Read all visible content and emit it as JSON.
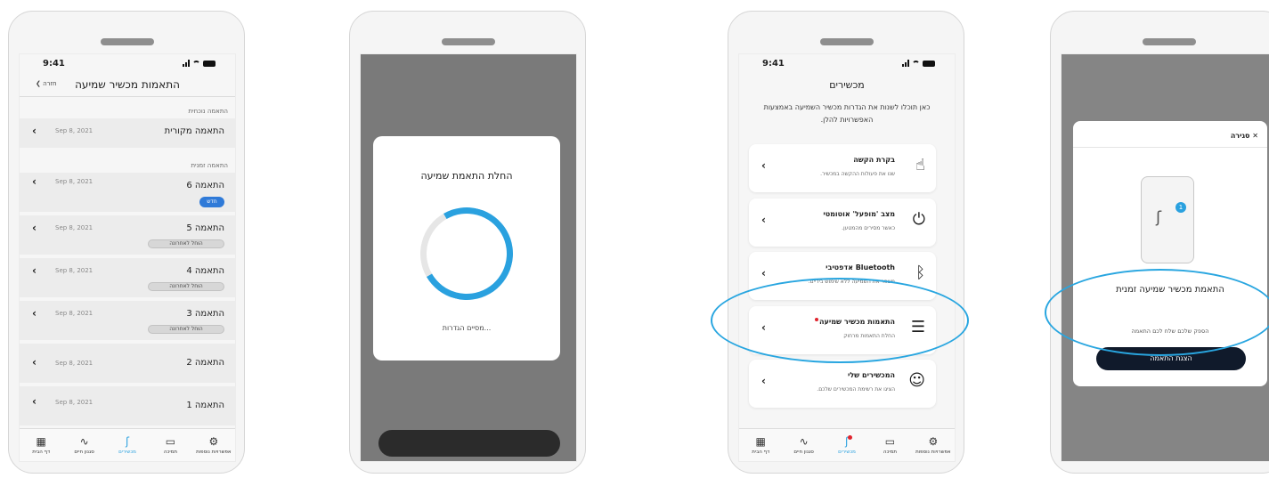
{
  "status_time": "9:41",
  "phone1": {
    "header_title": "התאמות מכשיר שמיעה",
    "back_label": "חזרה",
    "current_section": "התאמה נוכחית",
    "original_fitting": {
      "name": "התאמה מקורית",
      "date": "Sep 8, 2021"
    },
    "temp_section": "התאמה זמנית",
    "fittings": [
      {
        "name": "התאמה 6",
        "date": "Sep 8, 2021",
        "badge": "חדש"
      },
      {
        "name": "התאמה 5",
        "date": "Sep 8, 2021",
        "badge": "הוחל לאחרונה"
      },
      {
        "name": "התאמה 4",
        "date": "Sep 8, 2021",
        "badge": "הוחל לאחרונה"
      },
      {
        "name": "התאמה 3",
        "date": "Sep 8, 2021",
        "badge": "הוחל לאחרונה"
      },
      {
        "name": "התאמה 2",
        "date": "Sep 8, 2021"
      },
      {
        "name": "התאמה 1",
        "date": "Sep 8, 2021"
      }
    ]
  },
  "tabs": [
    "אפשרויות נוספות",
    "תמיכה",
    "מכשירים",
    "סגנון חיים",
    "דף הבית"
  ],
  "phone2": {
    "modal_title": "החלת התאמת שמיעה",
    "progress": 0.75,
    "footer": "...מסיים הגדרות"
  },
  "phone3": {
    "title": "מכשירים",
    "description": "כאן תוכלו לשנות את הגדרות מכשיר השמיעה באמצעות האפשרויות להלן.",
    "cards": [
      {
        "title": "בקרת הקשה",
        "subtitle": "שנו את פעולות ההקשה במכשיר.",
        "icon": "tap-icon"
      },
      {
        "title": "מצב 'מופעל' אוטומטי",
        "subtitle": "כאשר מסירים מהמטען.",
        "icon": "power-icon"
      },
      {
        "title": "Bluetooth אדפטיבי",
        "subtitle": "משפר את השמיעה ללא שימוש בידיים.",
        "icon": "bluetooth-icon"
      },
      {
        "title": "התאמות מכשיר שמיעה",
        "subtitle": "החלת התאמות מרחוק",
        "icon": "sliders-icon"
      },
      {
        "title": "המכשירים שלי",
        "subtitle": "הציגו את רשימת המכשירים שלכם.",
        "icon": "person-sound-icon"
      }
    ]
  },
  "phone4": {
    "close_label": "סגירה",
    "badge_count": "1",
    "title": "התאמת מכשיר שמיעה זמנית",
    "subtitle": "הספק שלכם שלח לכם התאמה",
    "button": "הצגת התאמה"
  },
  "colors": {
    "accent": "#2aa1df",
    "ring": "#29a6e0",
    "badge_new": "#2f7ad8",
    "button_dark": "#101a2b",
    "notification_dot": "#e0242e"
  }
}
